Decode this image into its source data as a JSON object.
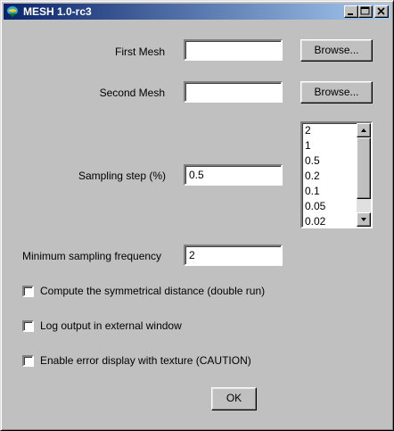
{
  "window": {
    "title": "MESH 1.0-rc3"
  },
  "titlebar_buttons": {
    "minimize": "minimize-icon",
    "maximize": "maximize-icon",
    "close": "close-icon"
  },
  "form": {
    "first_mesh": {
      "label": "First Mesh",
      "value": "",
      "browse_label": "Browse..."
    },
    "second_mesh": {
      "label": "Second Mesh",
      "value": "",
      "browse_label": "Browse..."
    },
    "sampling_step": {
      "label": "Sampling step (%)",
      "value": "0.5",
      "options": [
        "2",
        "1",
        "0.5",
        "0.2",
        "0.1",
        "0.05",
        "0.02"
      ]
    },
    "min_sampling_freq": {
      "label": "Minimum sampling frequency",
      "value": "2"
    },
    "checkboxes": [
      {
        "label": "Compute the symmetrical distance (double run)",
        "checked": false
      },
      {
        "label": "Log output in external window",
        "checked": false
      },
      {
        "label": "Enable error display with texture (CAUTION)",
        "checked": false
      }
    ],
    "ok_label": "OK"
  }
}
